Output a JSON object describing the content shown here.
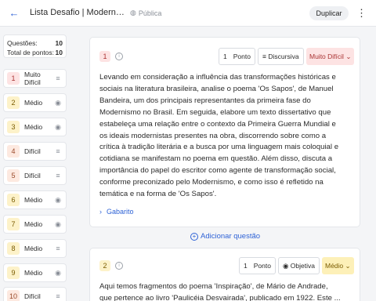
{
  "header": {
    "back_icon": "arrow-left-icon",
    "title": "Lista Desafio | Modernismo...",
    "visibility": "Pública",
    "duplicate_label": "Duplicar",
    "more_icon": "kebab-icon"
  },
  "sidebar": {
    "questions_label": "Questões:",
    "questions_count": "10",
    "points_label": "Total de pontos:",
    "points_count": "10",
    "items": [
      {
        "num": "1",
        "label": "Muito Difícil",
        "icon": "lines-icon",
        "level": "md"
      },
      {
        "num": "2",
        "label": "Médio",
        "icon": "radio-icon",
        "level": "m"
      },
      {
        "num": "3",
        "label": "Médio",
        "icon": "radio-icon",
        "level": "m"
      },
      {
        "num": "4",
        "label": "Difícil",
        "icon": "lines-icon",
        "level": "d"
      },
      {
        "num": "5",
        "label": "Difícil",
        "icon": "lines-icon",
        "level": "d"
      },
      {
        "num": "6",
        "label": "Médio",
        "icon": "radio-icon",
        "level": "m"
      },
      {
        "num": "7",
        "label": "Médio",
        "icon": "radio-icon",
        "level": "m"
      },
      {
        "num": "8",
        "label": "Médio",
        "icon": "lines-icon",
        "level": "m"
      },
      {
        "num": "9",
        "label": "Médio",
        "icon": "radio-icon",
        "level": "m"
      },
      {
        "num": "10",
        "label": "Difícil",
        "icon": "lines-icon",
        "level": "d"
      }
    ]
  },
  "q1": {
    "num": "1",
    "points_value": "1",
    "points_label": "Ponto",
    "type_label": "Discursiva",
    "difficulty": "Muito Difícil",
    "lines": [
      "Levando em consideração a influência das transformações históricas e",
      "sociais na literatura brasileira, analise o poema 'Os Sapos', de Manuel",
      "Bandeira, um dos principais representantes da primeira fase do",
      "Modernismo no Brasil. Em seguida, elabore um texto dissertativo que",
      "estabeleça uma relação entre o contexto da Primeira Guerra Mundial e",
      "os ideais modernistas presentes na obra, discorrendo sobre como a",
      "crítica à tradição literária e a busca por uma linguagem mais coloquial e",
      "cotidiana se manifestam no poema em questão. Além disso, discuta a",
      "importância do papel do escritor como agente de transformação social,",
      "conforme preconizado pelo Modernismo, e como isso é refletido na",
      "temática e na forma de 'Os Sapos'."
    ],
    "gabarito_label": "Gabarito"
  },
  "add_question_label": "Adicionar questão",
  "q2": {
    "num": "2",
    "points_value": "1",
    "points_label": "Ponto",
    "type_label": "Objetiva",
    "difficulty": "Médio",
    "lines": [
      "Aqui temos fragmentos do poema 'Inspiração', de Mário de Andrade,",
      "que pertence ao livro 'Paulicéia Desvairada', publicado em 1922. Este ..."
    ]
  },
  "colors": {
    "accent": "#2f63d6",
    "very_hard_bg": "#fde3e3",
    "medium_bg": "#fdf0b8",
    "hard_bg": "#fde9e0"
  }
}
